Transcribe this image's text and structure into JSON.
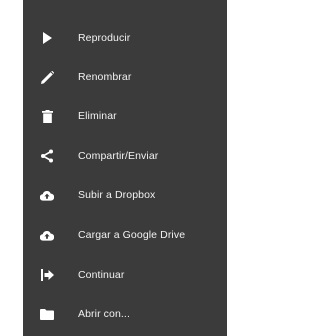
{
  "menu": {
    "background": "#3b3b3b",
    "text_color": "#f2f2f2",
    "items": [
      {
        "label": "Reproducir",
        "icon": "play-icon"
      },
      {
        "label": "Renombrar",
        "icon": "pencil-icon"
      },
      {
        "label": "Eliminar",
        "icon": "trash-icon"
      },
      {
        "label": "Compartir/Enviar",
        "icon": "share-icon"
      },
      {
        "label": "Subir a Dropbox",
        "icon": "cloud-upload-icon"
      },
      {
        "label": "Cargar a Google Drive",
        "icon": "cloud-upload-icon"
      },
      {
        "label": "Continuar",
        "icon": "forward-icon"
      },
      {
        "label": "Abrir con...",
        "icon": "folder-icon"
      }
    ]
  }
}
